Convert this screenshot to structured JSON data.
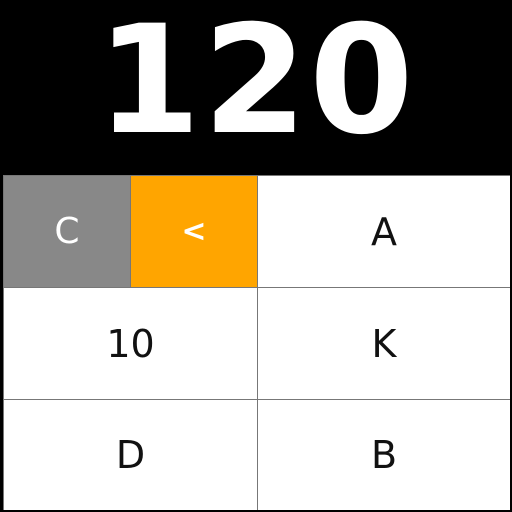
{
  "display": {
    "value": "120"
  },
  "keypad": {
    "clear_label": "C",
    "back_label": "<",
    "keys": {
      "a": "A",
      "ten": "10",
      "k": "K",
      "d": "D",
      "b": "B"
    }
  },
  "colors": {
    "background": "#000000",
    "clear_key": "#888888",
    "back_key": "#ffa500",
    "key": "#ffffff"
  }
}
